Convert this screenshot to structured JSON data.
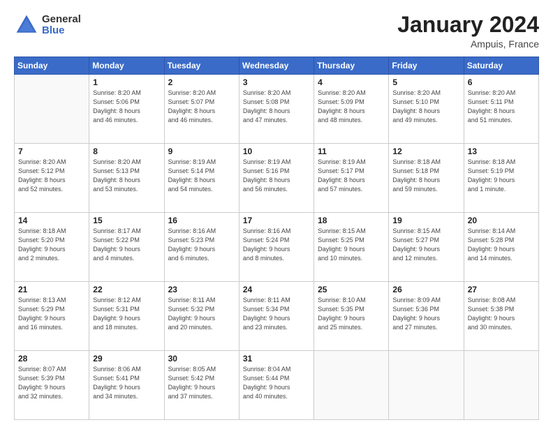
{
  "logo": {
    "general": "General",
    "blue": "Blue"
  },
  "title": {
    "month": "January 2024",
    "location": "Ampuis, France"
  },
  "weekdays": [
    "Sunday",
    "Monday",
    "Tuesday",
    "Wednesday",
    "Thursday",
    "Friday",
    "Saturday"
  ],
  "weeks": [
    [
      {
        "day": "",
        "info": ""
      },
      {
        "day": "1",
        "info": "Sunrise: 8:20 AM\nSunset: 5:06 PM\nDaylight: 8 hours\nand 46 minutes."
      },
      {
        "day": "2",
        "info": "Sunrise: 8:20 AM\nSunset: 5:07 PM\nDaylight: 8 hours\nand 46 minutes."
      },
      {
        "day": "3",
        "info": "Sunrise: 8:20 AM\nSunset: 5:08 PM\nDaylight: 8 hours\nand 47 minutes."
      },
      {
        "day": "4",
        "info": "Sunrise: 8:20 AM\nSunset: 5:09 PM\nDaylight: 8 hours\nand 48 minutes."
      },
      {
        "day": "5",
        "info": "Sunrise: 8:20 AM\nSunset: 5:10 PM\nDaylight: 8 hours\nand 49 minutes."
      },
      {
        "day": "6",
        "info": "Sunrise: 8:20 AM\nSunset: 5:11 PM\nDaylight: 8 hours\nand 51 minutes."
      }
    ],
    [
      {
        "day": "7",
        "info": "Sunrise: 8:20 AM\nSunset: 5:12 PM\nDaylight: 8 hours\nand 52 minutes."
      },
      {
        "day": "8",
        "info": "Sunrise: 8:20 AM\nSunset: 5:13 PM\nDaylight: 8 hours\nand 53 minutes."
      },
      {
        "day": "9",
        "info": "Sunrise: 8:19 AM\nSunset: 5:14 PM\nDaylight: 8 hours\nand 54 minutes."
      },
      {
        "day": "10",
        "info": "Sunrise: 8:19 AM\nSunset: 5:16 PM\nDaylight: 8 hours\nand 56 minutes."
      },
      {
        "day": "11",
        "info": "Sunrise: 8:19 AM\nSunset: 5:17 PM\nDaylight: 8 hours\nand 57 minutes."
      },
      {
        "day": "12",
        "info": "Sunrise: 8:18 AM\nSunset: 5:18 PM\nDaylight: 8 hours\nand 59 minutes."
      },
      {
        "day": "13",
        "info": "Sunrise: 8:18 AM\nSunset: 5:19 PM\nDaylight: 9 hours\nand 1 minute."
      }
    ],
    [
      {
        "day": "14",
        "info": "Sunrise: 8:18 AM\nSunset: 5:20 PM\nDaylight: 9 hours\nand 2 minutes."
      },
      {
        "day": "15",
        "info": "Sunrise: 8:17 AM\nSunset: 5:22 PM\nDaylight: 9 hours\nand 4 minutes."
      },
      {
        "day": "16",
        "info": "Sunrise: 8:16 AM\nSunset: 5:23 PM\nDaylight: 9 hours\nand 6 minutes."
      },
      {
        "day": "17",
        "info": "Sunrise: 8:16 AM\nSunset: 5:24 PM\nDaylight: 9 hours\nand 8 minutes."
      },
      {
        "day": "18",
        "info": "Sunrise: 8:15 AM\nSunset: 5:25 PM\nDaylight: 9 hours\nand 10 minutes."
      },
      {
        "day": "19",
        "info": "Sunrise: 8:15 AM\nSunset: 5:27 PM\nDaylight: 9 hours\nand 12 minutes."
      },
      {
        "day": "20",
        "info": "Sunrise: 8:14 AM\nSunset: 5:28 PM\nDaylight: 9 hours\nand 14 minutes."
      }
    ],
    [
      {
        "day": "21",
        "info": "Sunrise: 8:13 AM\nSunset: 5:29 PM\nDaylight: 9 hours\nand 16 minutes."
      },
      {
        "day": "22",
        "info": "Sunrise: 8:12 AM\nSunset: 5:31 PM\nDaylight: 9 hours\nand 18 minutes."
      },
      {
        "day": "23",
        "info": "Sunrise: 8:11 AM\nSunset: 5:32 PM\nDaylight: 9 hours\nand 20 minutes."
      },
      {
        "day": "24",
        "info": "Sunrise: 8:11 AM\nSunset: 5:34 PM\nDaylight: 9 hours\nand 23 minutes."
      },
      {
        "day": "25",
        "info": "Sunrise: 8:10 AM\nSunset: 5:35 PM\nDaylight: 9 hours\nand 25 minutes."
      },
      {
        "day": "26",
        "info": "Sunrise: 8:09 AM\nSunset: 5:36 PM\nDaylight: 9 hours\nand 27 minutes."
      },
      {
        "day": "27",
        "info": "Sunrise: 8:08 AM\nSunset: 5:38 PM\nDaylight: 9 hours\nand 30 minutes."
      }
    ],
    [
      {
        "day": "28",
        "info": "Sunrise: 8:07 AM\nSunset: 5:39 PM\nDaylight: 9 hours\nand 32 minutes."
      },
      {
        "day": "29",
        "info": "Sunrise: 8:06 AM\nSunset: 5:41 PM\nDaylight: 9 hours\nand 34 minutes."
      },
      {
        "day": "30",
        "info": "Sunrise: 8:05 AM\nSunset: 5:42 PM\nDaylight: 9 hours\nand 37 minutes."
      },
      {
        "day": "31",
        "info": "Sunrise: 8:04 AM\nSunset: 5:44 PM\nDaylight: 9 hours\nand 40 minutes."
      },
      {
        "day": "",
        "info": ""
      },
      {
        "day": "",
        "info": ""
      },
      {
        "day": "",
        "info": ""
      }
    ]
  ]
}
